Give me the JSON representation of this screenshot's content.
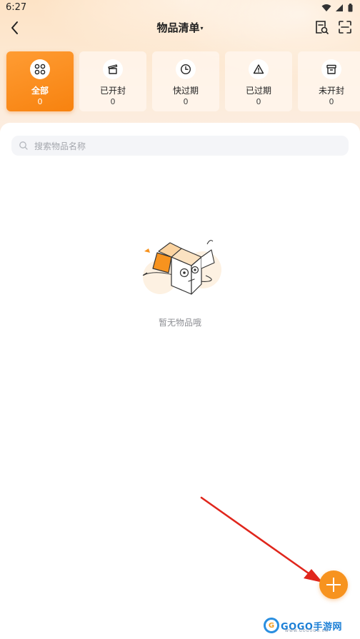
{
  "status_bar": {
    "time": "6:27"
  },
  "header": {
    "title": "物品清单",
    "title_caret": "▾"
  },
  "categories": [
    {
      "label": "全部",
      "count": "0",
      "icon": "grid-dots-icon",
      "active": true
    },
    {
      "label": "已开封",
      "count": "0",
      "icon": "opened-box-icon",
      "active": false
    },
    {
      "label": "快过期",
      "count": "0",
      "icon": "clock-icon",
      "active": false
    },
    {
      "label": "已过期",
      "count": "0",
      "icon": "warning-icon",
      "active": false
    },
    {
      "label": "未开封",
      "count": "0",
      "icon": "closed-box-icon",
      "active": false
    }
  ],
  "search": {
    "placeholder": "搜索物品名称"
  },
  "empty_state": {
    "text": "暂无物品哦",
    "illustration": "empty-box-illustration"
  },
  "watermark": {
    "brand": "GOGO手游网",
    "url": "WWW.GOGOGO.CN"
  },
  "colors": {
    "accent": "#f7931f",
    "active_tab": "#f7820f",
    "arrow": "#e0261c"
  }
}
